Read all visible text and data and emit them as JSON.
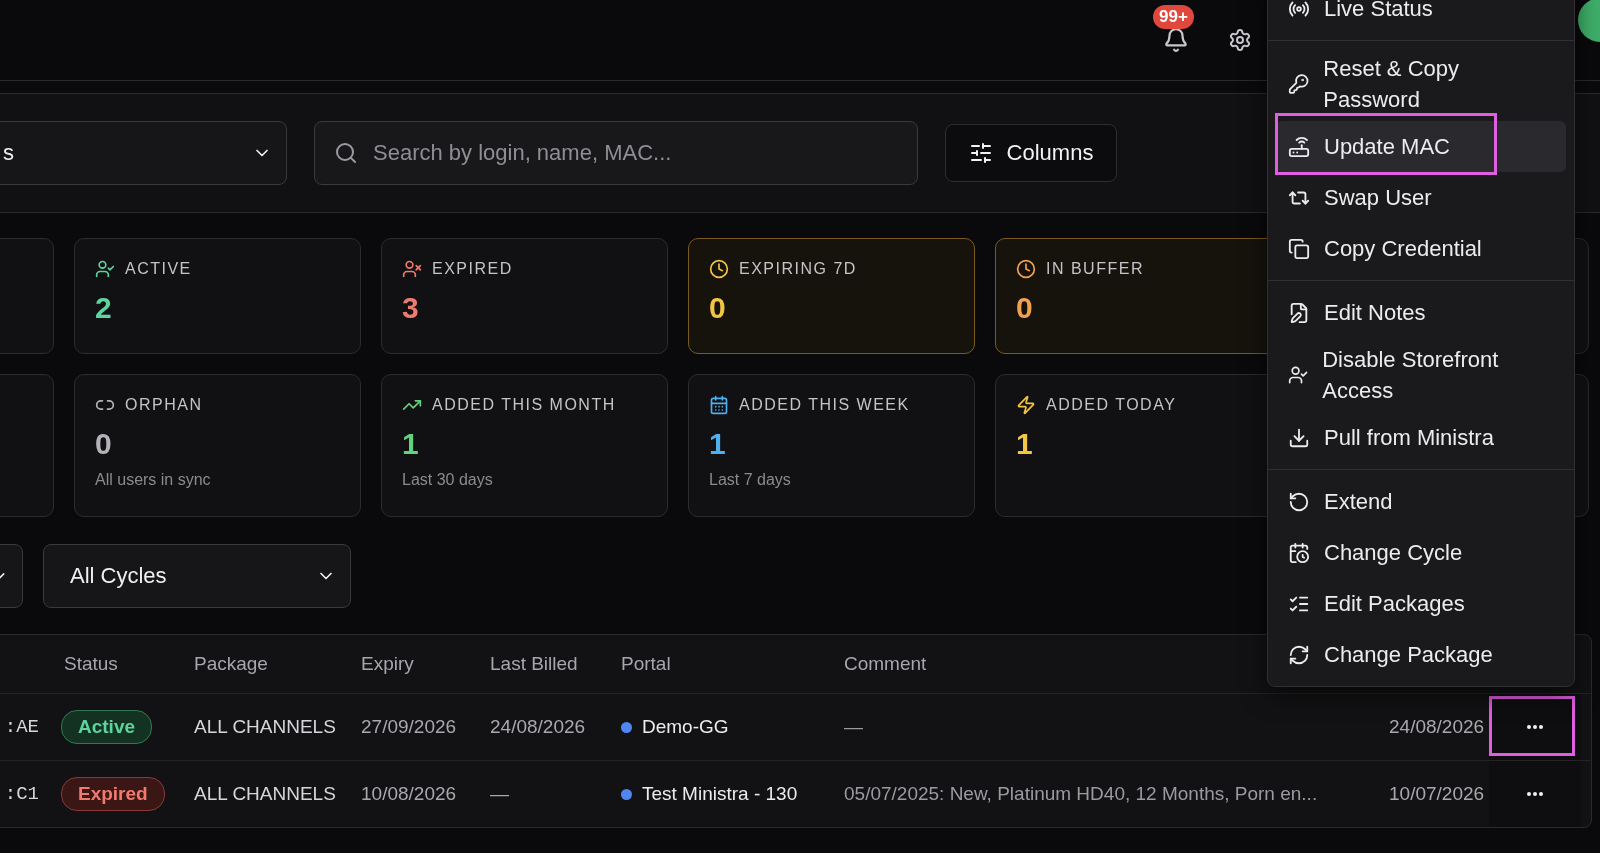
{
  "header": {
    "notifications_badge": "99+"
  },
  "toolbar": {
    "filter_select": {
      "value": "s"
    },
    "search": {
      "placeholder": "Search by login, name, MAC..."
    },
    "columns_button": "Columns"
  },
  "stats": [
    {
      "label": "ACTIVE",
      "value": "2",
      "color": "#5dd39e",
      "highlighted": false
    },
    {
      "label": "EXPIRED",
      "value": "3",
      "color": "#ee7b6f",
      "highlighted": false
    },
    {
      "label": "EXPIRING 7D",
      "value": "0",
      "color": "#f3c545",
      "highlighted": true
    },
    {
      "label": "IN BUFFER",
      "value": "0",
      "color": "#f2a24f",
      "highlighted": true
    },
    {
      "label": "ORPHAN",
      "value": "0",
      "color": "#b4b4b8",
      "highlighted": false,
      "note": "All users in sync"
    },
    {
      "label": "ADDED THIS MONTH",
      "value": "1",
      "color": "#62d37c",
      "highlighted": false,
      "note": "Last 30 days"
    },
    {
      "label": "ADDED THIS WEEK",
      "value": "1",
      "color": "#4fb0f0",
      "highlighted": false,
      "note": "Last 7 days"
    },
    {
      "label": "ADDED TODAY",
      "value": "1",
      "color": "#f3c545",
      "highlighted": false
    }
  ],
  "cycle_select": {
    "value": "All Cycles"
  },
  "table": {
    "columns": [
      "Status",
      "Package",
      "Expiry",
      "Last Billed",
      "Portal",
      "Comment"
    ],
    "rows": [
      {
        "mac": ":AE",
        "status": {
          "label": "Active",
          "kind": "active"
        },
        "package": "ALL CHANNELS",
        "expiry": "27/09/2026",
        "last_billed": "24/08/2026",
        "portal": {
          "name": "Demo-GG",
          "color": "#4f86f0"
        },
        "comment": "—",
        "column_8": "24/08/2026",
        "menu_open": true
      },
      {
        "mac": ":C1",
        "status": {
          "label": "Expired",
          "kind": "expired"
        },
        "package": "ALL CHANNELS",
        "expiry": "10/08/2026",
        "last_billed": "—",
        "portal": {
          "name": "Test Ministra - 130",
          "color": "#4f86f0"
        },
        "comment": "05/07/2025: New, Platinum HD40, 12 Months, Porn en...",
        "column_8": "10/07/2026",
        "menu_open": false
      }
    ]
  },
  "row_menu": {
    "groups": [
      [
        {
          "label": "Live Status",
          "selected": false,
          "annotated": false
        }
      ],
      [
        {
          "label": "Reset & Copy Password",
          "selected": false,
          "annotated": false
        },
        {
          "label": "Update MAC",
          "selected": true,
          "annotated": true
        },
        {
          "label": "Swap User",
          "selected": false,
          "annotated": false
        },
        {
          "label": "Copy Credential",
          "selected": false,
          "annotated": false
        }
      ],
      [
        {
          "label": "Edit Notes",
          "selected": false,
          "annotated": false
        },
        {
          "label": "Disable Storefront Access",
          "selected": false,
          "annotated": false
        },
        {
          "label": "Pull from Ministra",
          "selected": false,
          "annotated": false
        }
      ],
      [
        {
          "label": "Extend",
          "selected": false,
          "annotated": false
        },
        {
          "label": "Change Cycle",
          "selected": false,
          "annotated": false
        },
        {
          "label": "Edit Packages",
          "selected": false,
          "annotated": false
        },
        {
          "label": "Change Package",
          "selected": false,
          "annotated": false
        }
      ]
    ]
  }
}
